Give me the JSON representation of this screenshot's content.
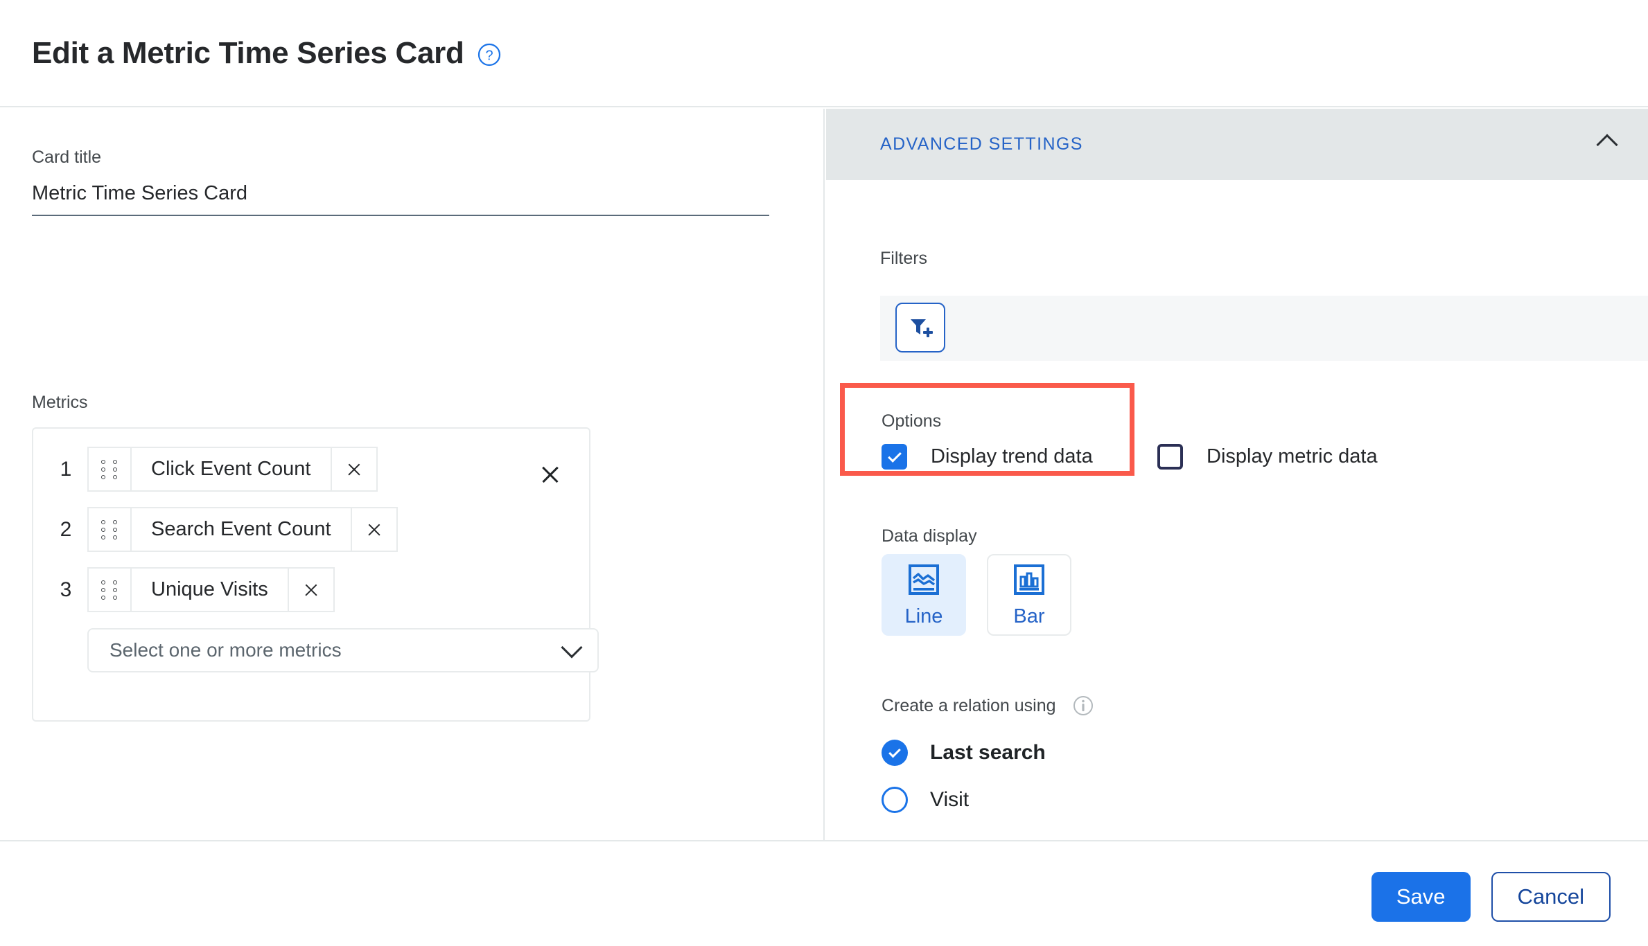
{
  "header": {
    "title": "Edit a Metric Time Series Card",
    "help_icon": "help-circle-icon"
  },
  "left_panel": {
    "card_title": {
      "label": "Card title",
      "value": "Metric Time Series Card"
    },
    "metrics": {
      "label": "Metrics",
      "items": [
        {
          "index": "1",
          "name": "Click Event Count",
          "drag_icon": "drag-handle-icon",
          "remove_icon": "close-icon"
        },
        {
          "index": "2",
          "name": "Search Event Count",
          "drag_icon": "drag-handle-icon",
          "remove_icon": "close-icon"
        },
        {
          "index": "3",
          "name": "Unique Visits",
          "drag_icon": "drag-handle-icon",
          "remove_icon": "close-icon"
        }
      ],
      "row_remove_icon": "close-icon",
      "select_placeholder": "Select one or more metrics",
      "select_chevron": "chevron-down-icon"
    }
  },
  "right_panel": {
    "advanced_settings": {
      "label": "ADVANCED SETTINGS",
      "collapse_icon": "chevron-up-icon",
      "accent_color": "#2563c7",
      "band_color": "#e3e7e8"
    },
    "filters": {
      "label": "Filters",
      "add_filter_icon": "filter-add-icon"
    },
    "options": {
      "label": "Options",
      "highlight_color": "#fa5a4b",
      "checkboxes": [
        {
          "label": "Display trend data",
          "checked": true
        },
        {
          "label": "Display metric data",
          "checked": false
        }
      ]
    },
    "data_display": {
      "label": "Data display",
      "options": [
        {
          "label": "Line",
          "icon": "line-chart-icon",
          "selected": true
        },
        {
          "label": "Bar",
          "icon": "bar-chart-icon",
          "selected": false
        }
      ]
    },
    "relation": {
      "label": "Create a relation using",
      "info_icon": "info-icon",
      "options": [
        {
          "label": "Last search",
          "selected": true
        },
        {
          "label": "Visit",
          "selected": false
        }
      ]
    }
  },
  "footer": {
    "save_label": "Save",
    "cancel_label": "Cancel",
    "save_color": "#1b72e8"
  }
}
